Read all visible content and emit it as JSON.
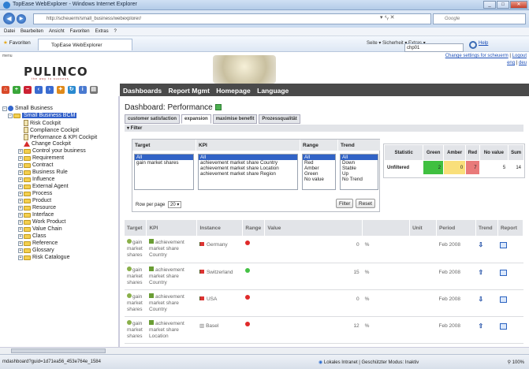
{
  "window": {
    "title": "TopEase WebExplorer - Windows Internet Explorer",
    "min": "_",
    "max": "□",
    "close": "✕"
  },
  "address": {
    "url": "http://scheuerm/small_business/webexplorer/",
    "search_placeholder": "Google",
    "icons": "▾ ⁴ᵧ ✕"
  },
  "menubar": [
    "Datei",
    "Bearbeiten",
    "Ansicht",
    "Favoriten",
    "Extras",
    "?"
  ],
  "favbar": {
    "favorites": "Favoriten",
    "tab": "TopEase WebExplorer",
    "tools": "Seite ▾  Sicherheit ▾  Extras ▾"
  },
  "app": {
    "menu_label": "menu",
    "logo": "PULINCO",
    "logo_tag": "the way to success",
    "settings_link": "Change settings for scheuerm",
    "logout": "Logout",
    "lang_en": "eng",
    "lang_de": "deu",
    "user": "chp01",
    "help": "Help"
  },
  "nav": [
    "Dashboards",
    "Report Mgmt",
    "Homepage",
    "Language"
  ],
  "tree": {
    "root": "Small Business",
    "selected": "Small Business BCM",
    "items": [
      "Risk Cockpit",
      "Compliance Cockpit",
      "Performance & KPI Cockpit",
      "Change Cockpit",
      "Control your business",
      "Requirement",
      "Contract",
      "Business Rule",
      "Influence",
      "External Agent",
      "Process",
      "Product",
      "Resource",
      "Interface",
      "Work Product",
      "Value Chain",
      "Class",
      "Reference",
      "Glossary",
      "Risk Catalogue"
    ]
  },
  "dashboard": {
    "title": "Dashboard: Performance",
    "tabs": [
      "customer satisfaction",
      "expansion",
      "maximise benefit",
      "Prozessqualität"
    ],
    "active_tab": 1,
    "filter_label": "▾ Filter"
  },
  "filter": {
    "headers": {
      "target": "Target",
      "kpi": "KPI",
      "range": "Range",
      "trend": "Trend"
    },
    "target_options": [
      "All",
      "gain market shares"
    ],
    "kpi_options": [
      "All",
      "achievement market share Country",
      "achievement market share Location",
      "achievement market share Region"
    ],
    "range_options": [
      "All",
      "Red",
      "Amber",
      "Green",
      "No value"
    ],
    "trend_options": [
      "All",
      "Down",
      "Stable",
      "Up",
      "No Trend"
    ],
    "rows_per_page_label": "Row per page",
    "rows_per_page": "20",
    "filter_btn": "Filter",
    "reset_btn": "Reset"
  },
  "stats": {
    "headers": [
      "Statistic",
      "Green",
      "Amber",
      "Red",
      "No value",
      "Sum"
    ],
    "row": {
      "label": "Unfiltered",
      "green": "2",
      "amber": "0",
      "red": "7",
      "novalue": "5",
      "sum": "14"
    },
    "colors": {
      "green": "#40c040",
      "amber": "#f9df7a",
      "red": "#e97a7a"
    }
  },
  "results": {
    "headers": [
      "Target",
      "KPI",
      "Instance",
      "Range",
      "Value",
      "",
      "Unit",
      "Period",
      "Trend",
      "Report"
    ],
    "rows": [
      {
        "target": "gain market shares",
        "kpi": "achievement market share Country",
        "instance": "Germany",
        "range": "red",
        "value": "0",
        "unit": "%",
        "period": "Feb 2008",
        "trend": "down"
      },
      {
        "target": "gain market shares",
        "kpi": "achievement market share Country",
        "instance": "Switzerland",
        "range": "green",
        "value": "15",
        "unit": "%",
        "period": "Feb 2008",
        "trend": "up"
      },
      {
        "target": "gain market shares",
        "kpi": "achievement market share Country",
        "instance": "USA",
        "range": "red",
        "value": "0",
        "unit": "%",
        "period": "Feb 2008",
        "trend": "down"
      },
      {
        "target": "gain market shares",
        "kpi": "achievement market share Location",
        "instance": "Basel",
        "range": "red",
        "value": "12",
        "unit": "%",
        "period": "Feb 2008",
        "trend": "up"
      }
    ]
  },
  "status": {
    "url": "mdashboard?guid=1d71ea56_453e764e_1584",
    "zone": "Lokales Intranet | Geschützter Modus: Inaktiv",
    "zoom": "100%"
  }
}
